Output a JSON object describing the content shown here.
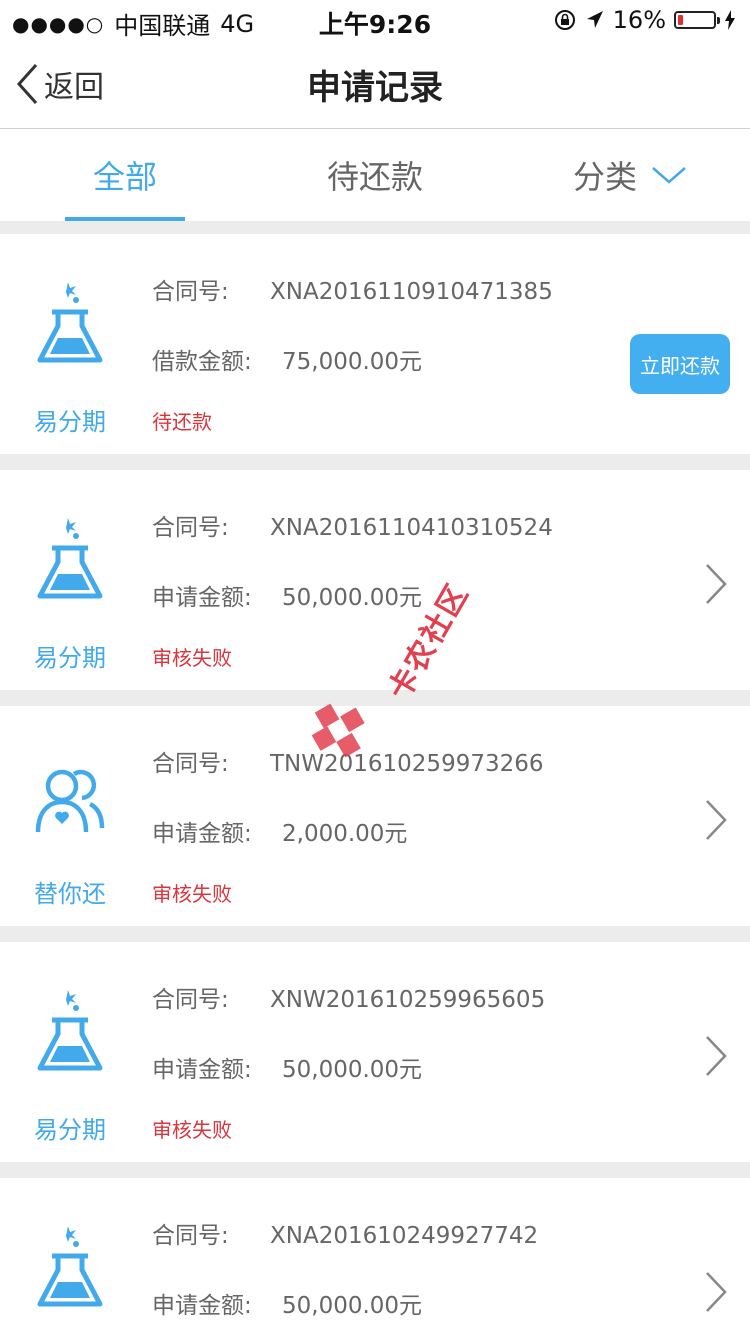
{
  "status_bar": {
    "signal": "●●●●○",
    "carrier": "中国联通",
    "network": "4G",
    "time": "上午9:26",
    "battery_percent": "16%",
    "battery_level": 0.16
  },
  "nav": {
    "back_label": "返回",
    "title": "申请记录"
  },
  "tabs": [
    {
      "label": "全部"
    },
    {
      "label": "待还款"
    },
    {
      "label": "分类"
    }
  ],
  "cards": [
    {
      "brand": "易分期",
      "contract_label": "合同号:",
      "contract": "XNA2016110910471385",
      "amount_label": "借款金额:",
      "amount": "75,000.00元",
      "status": "待还款",
      "action": "立即还款"
    },
    {
      "brand": "易分期",
      "contract_label": "合同号:",
      "contract": "XNA2016110410310524",
      "amount_label": "申请金额:",
      "amount": "50,000.00元",
      "status": "审核失败"
    },
    {
      "brand": "替你还",
      "contract_label": "合同号:",
      "contract": "TNW201610259973266",
      "amount_label": "申请金额:",
      "amount": "2,000.00元",
      "status": "审核失败"
    },
    {
      "brand": "易分期",
      "contract_label": "合同号:",
      "contract": "XNW201610259965605",
      "amount_label": "申请金额:",
      "amount": "50,000.00元",
      "status": "审核失败"
    },
    {
      "brand": "易分期",
      "contract_label": "合同号:",
      "contract": "XNA201610249927742",
      "amount_label": "申请金额:",
      "amount": "50,000.00元",
      "status": ""
    }
  ],
  "watermark": {
    "text": "卡农社区"
  },
  "colors": {
    "accent": "#42a9ea",
    "status_red": "#d9363e",
    "button": "#44aff0"
  },
  "icons": {
    "flask": "flask-icon",
    "people": "people-icon",
    "back": "chevron-left-icon",
    "chevron": "chevron-right-icon",
    "dropdown": "chevron-down-icon"
  }
}
